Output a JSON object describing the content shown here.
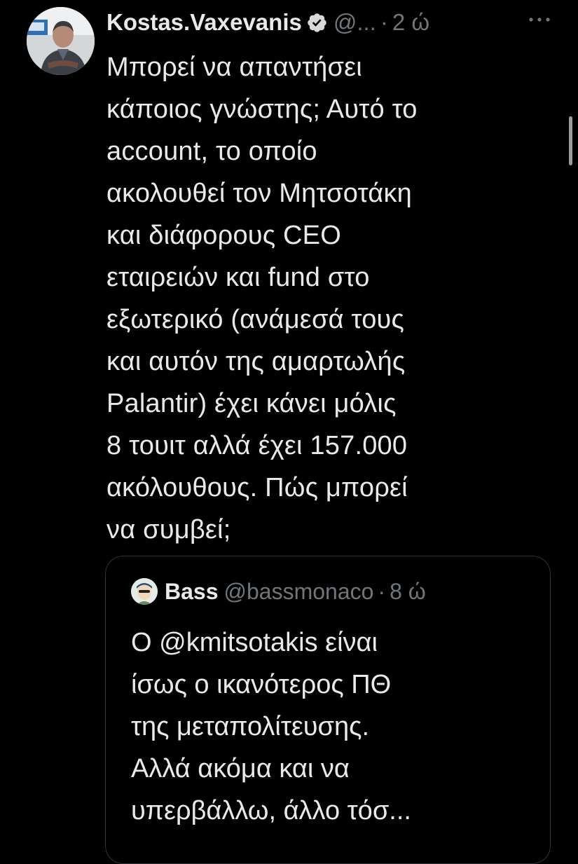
{
  "tweet": {
    "author_name": "Kostas.Vaxevanis",
    "handle": "@...",
    "separator": "·",
    "time": "2 ώ",
    "more_label": "···",
    "text_lines": [
      "Μπορεί να απαντήσει",
      "κάποιος γνώστης; Αυτό το",
      "account, το οποίο",
      "ακολουθεί τον Μητσοτάκη",
      "και διάφορους CEO",
      "εταιρειών και fund στο",
      "εξωτερικό (ανάμεσά τους",
      "και αυτόν της αμαρτωλής",
      "Palantir) έχει κάνει μόλις",
      "8 τουιτ αλλά έχει 157.000",
      "ακόλουθους. Πώς μπορεί",
      "να συμβεί;"
    ]
  },
  "quoted": {
    "author_name": "Bass",
    "handle": "@bassmonaco",
    "separator": "·",
    "time": "8 ώ",
    "text_lines": [
      "Ο @kmitsotakis είναι",
      "ίσως ο ικανότερος ΠΘ",
      "της μεταπολίτευσης.",
      "Αλλά ακόμα και να",
      "υπερβάλλω, άλλο τόσ..."
    ]
  },
  "colors": {
    "background": "#000000",
    "text_primary": "#e7e9ea",
    "text_muted": "#71767b",
    "border": "#2f3336"
  },
  "icons": {
    "verified": "verified-badge-icon",
    "more": "more-options-icon"
  }
}
